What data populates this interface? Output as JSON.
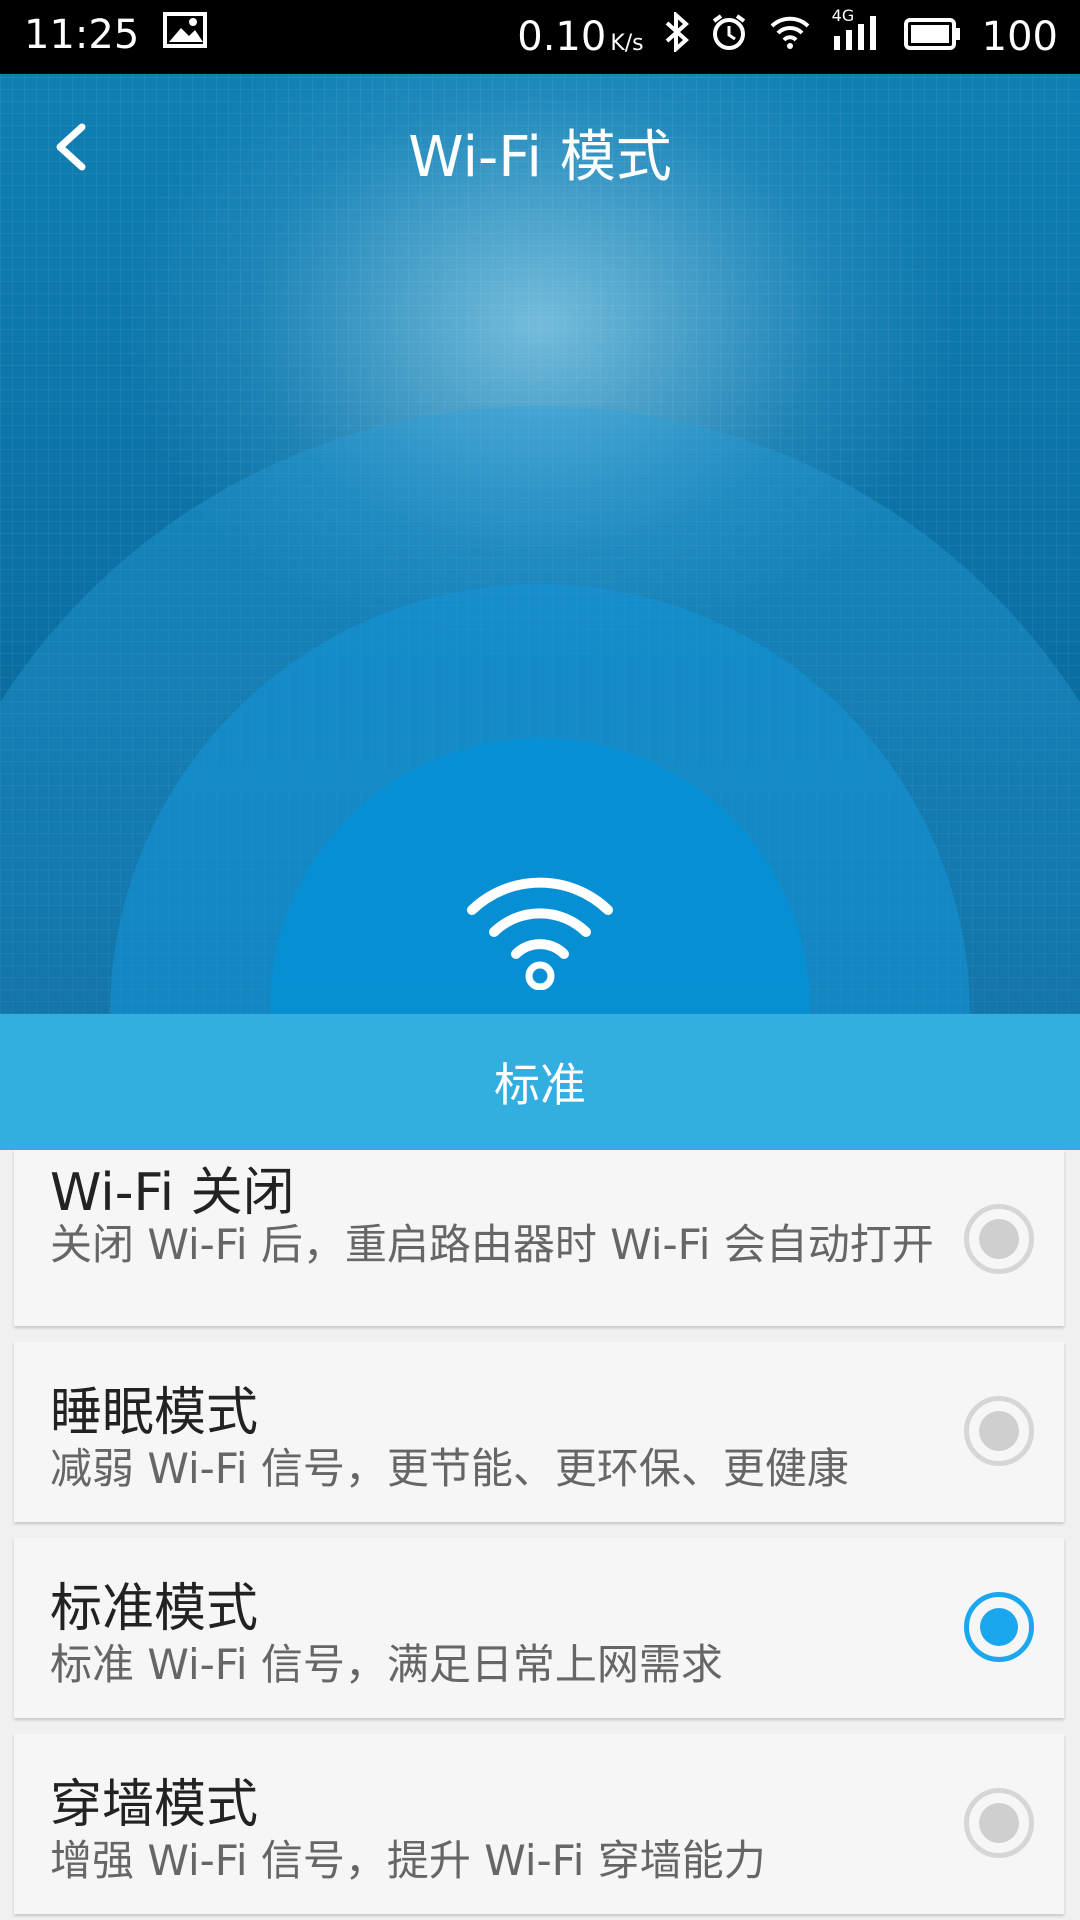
{
  "status_bar": {
    "time": "11:25",
    "net_speed": "0.10",
    "net_unit": "K/s",
    "network": "4G",
    "battery": "100",
    "icons": [
      "image-icon",
      "bluetooth-icon",
      "alarm-icon",
      "wifi-icon",
      "signal-icon",
      "battery-icon"
    ]
  },
  "header": {
    "title": "Wi-Fi 模式",
    "back_icon": "chevron-left-icon"
  },
  "hero": {
    "icon": "wifi-icon",
    "current_mode": "标准"
  },
  "modes": [
    {
      "title": "Wi-Fi 关闭",
      "desc": "关闭 Wi-Fi 后，重启路由器时 Wi-Fi 会自动打开",
      "selected": false
    },
    {
      "title": "睡眠模式",
      "desc": "减弱 Wi-Fi 信号，更节能、更环保、更健康",
      "selected": false
    },
    {
      "title": "标准模式",
      "desc": "标准 Wi-Fi 信号，满足日常上网需求",
      "selected": true
    },
    {
      "title": "穿墙模式",
      "desc": "增强 Wi-Fi 信号，提升 Wi-Fi 穿墙能力",
      "selected": false
    }
  ],
  "colors": {
    "accent": "#1aa7ee",
    "banner": "#33aee0",
    "hero_dark": "#0b6fa3"
  }
}
